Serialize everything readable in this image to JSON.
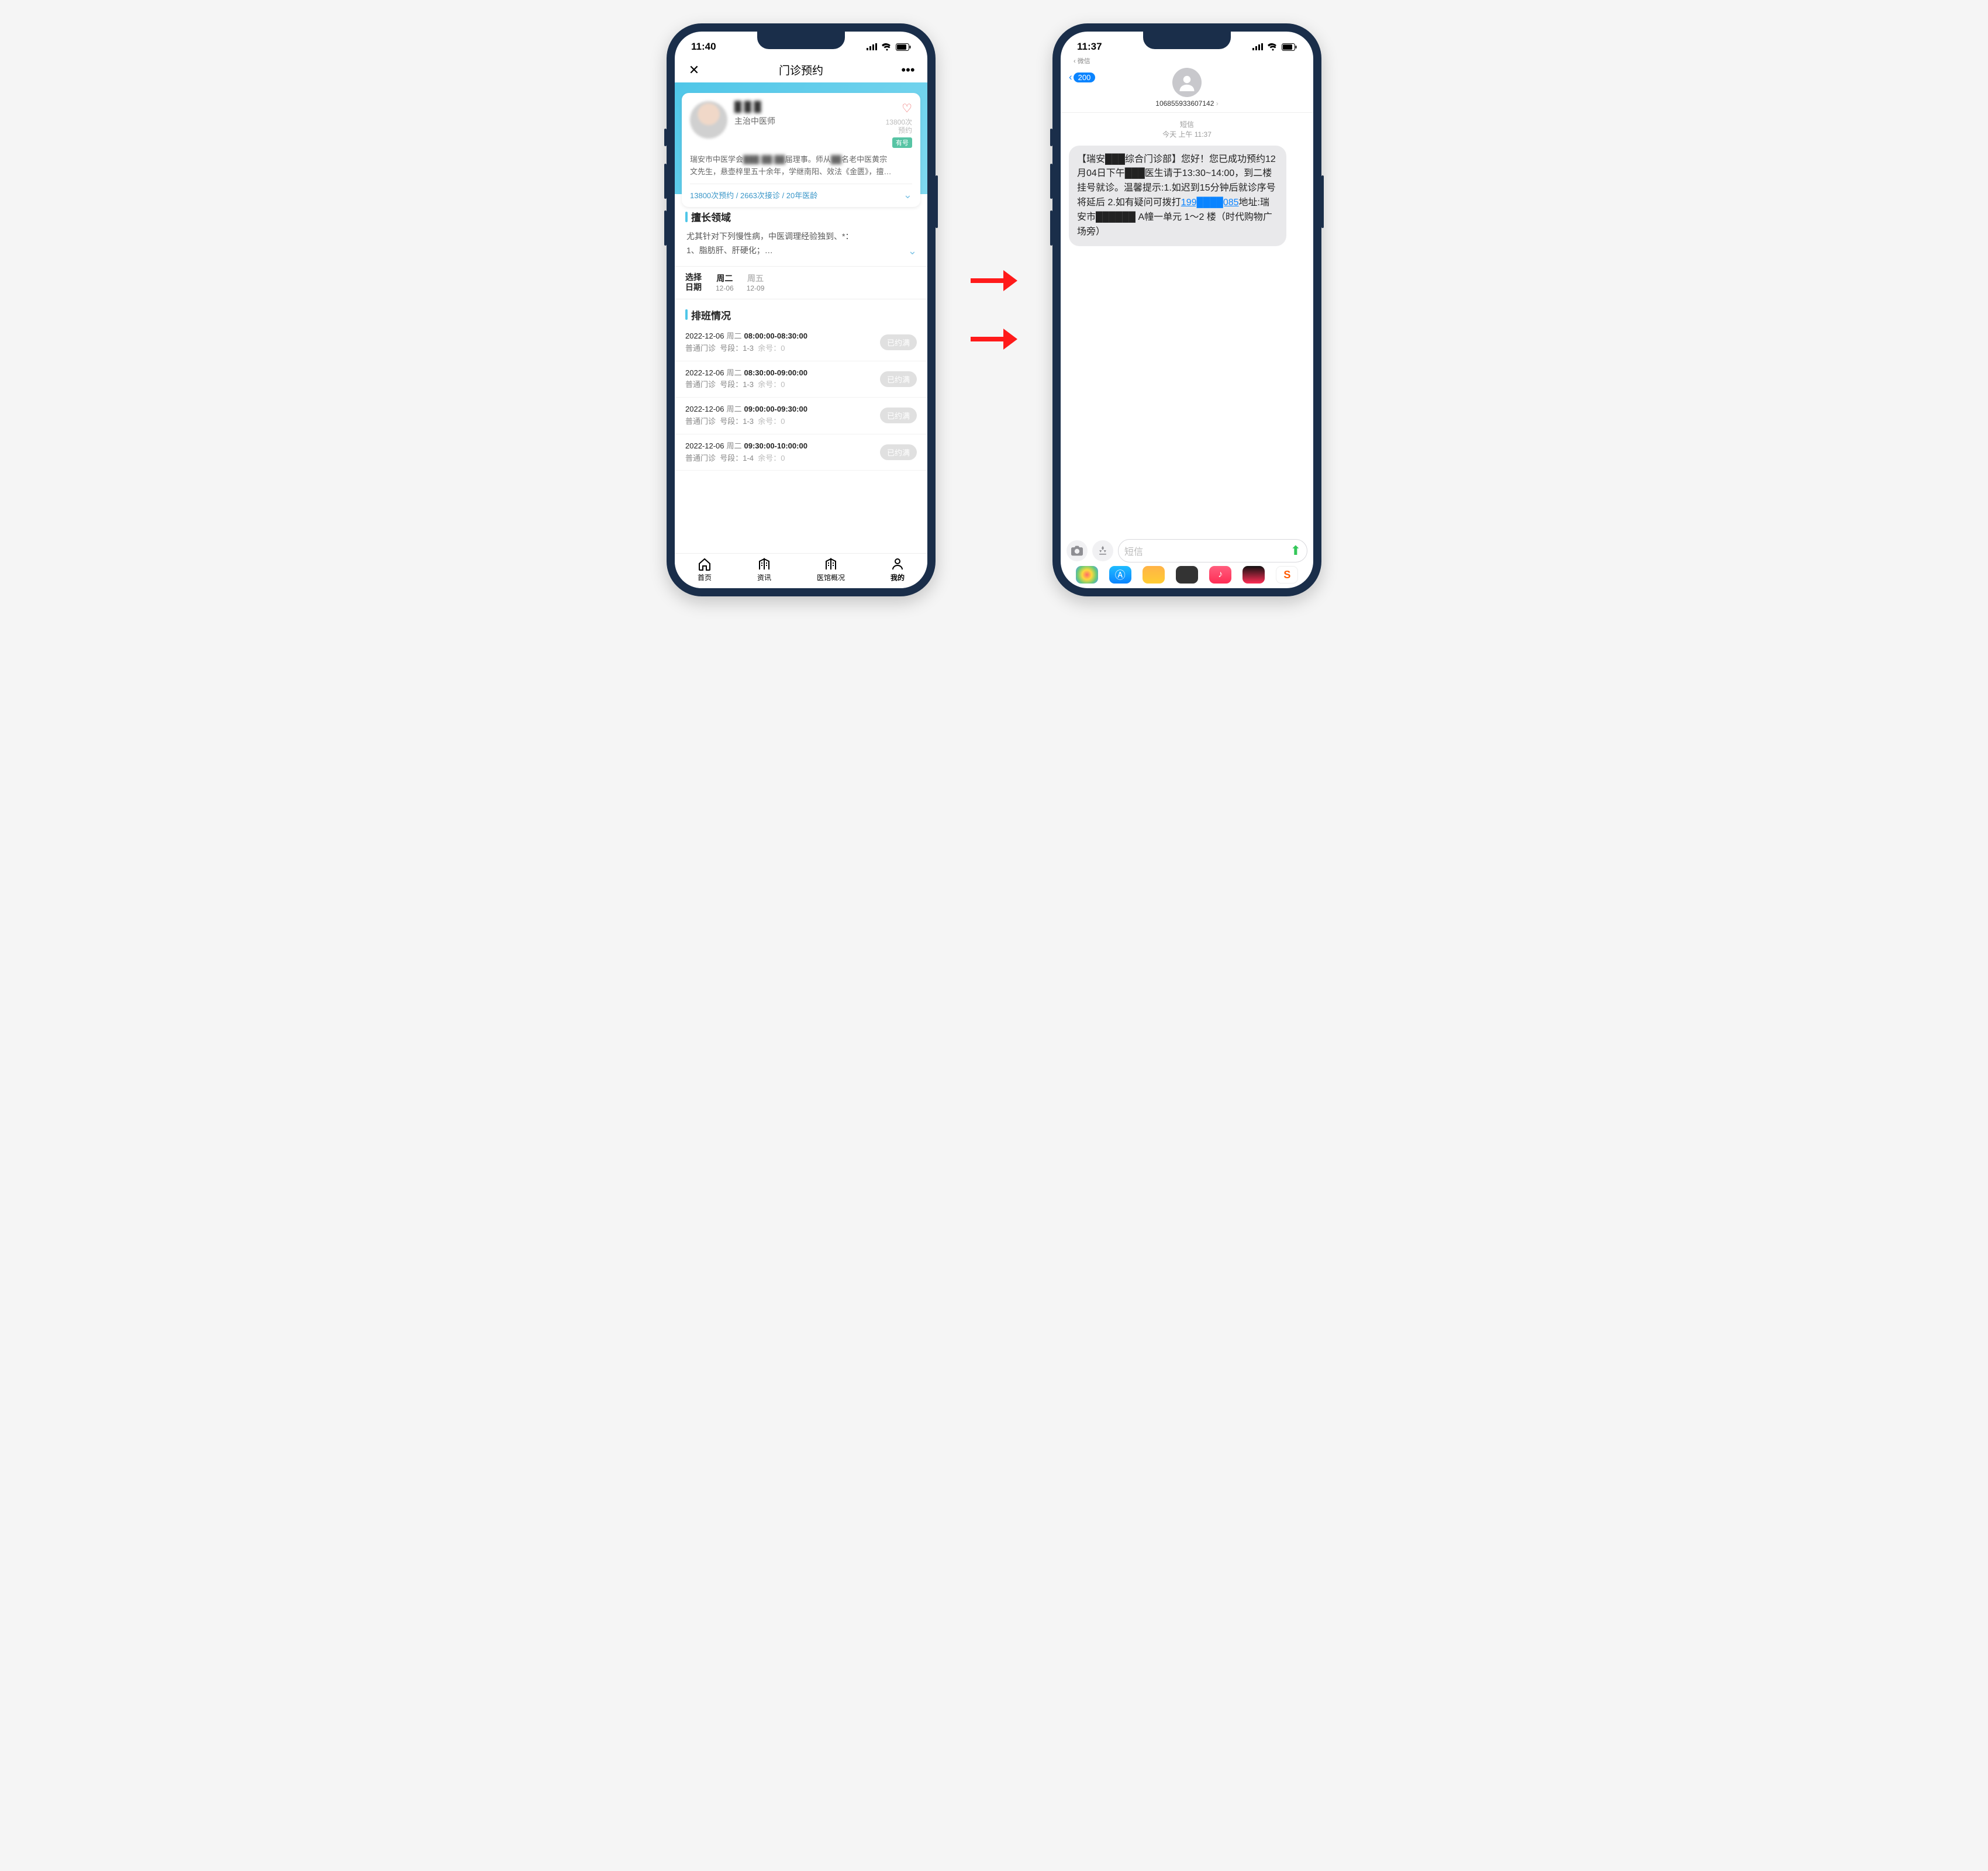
{
  "left": {
    "status": {
      "time": "11:40"
    },
    "nav": {
      "title": "门诊预约"
    },
    "doctor": {
      "name": "█ █ █",
      "title": "主治中医师",
      "count": "13800次",
      "count_label": "预约",
      "tag": "有号",
      "bio1_a": "瑞安市中医学会",
      "bio1_b": "届理事。师从",
      "bio1_c": "名老中医黄宗",
      "bio2": "文先生，悬壶梓里五十余年，学继南阳、效法《金匮》，擅…",
      "stats": "13800次预约 / 2663次接诊 / 20年医龄"
    },
    "expertise": {
      "title": "擅长领域",
      "line1": "尤其针对下列慢性病，中医调理经验独到、*：",
      "line2": "1、脂肪肝、肝硬化；…"
    },
    "dates": {
      "label1": "选择",
      "label2": "日期",
      "options": [
        {
          "dow": "周二",
          "day": "12-06",
          "active": true
        },
        {
          "dow": "周五",
          "day": "12-09",
          "active": false
        }
      ]
    },
    "schedule": {
      "title": "排班情况",
      "slots": [
        {
          "date": "2022-12-06",
          "dow": "周二",
          "time": "08:00:00-08:30:00",
          "type": "普通门诊",
          "range_label": "号段：",
          "range": "1-3",
          "remain_label": "余号：",
          "remain": "0",
          "status": "已约满"
        },
        {
          "date": "2022-12-06",
          "dow": "周二",
          "time": "08:30:00-09:00:00",
          "type": "普通门诊",
          "range_label": "号段：",
          "range": "1-3",
          "remain_label": "余号：",
          "remain": "0",
          "status": "已约满"
        },
        {
          "date": "2022-12-06",
          "dow": "周二",
          "time": "09:00:00-09:30:00",
          "type": "普通门诊",
          "range_label": "号段：",
          "range": "1-3",
          "remain_label": "余号：",
          "remain": "0",
          "status": "已约满"
        },
        {
          "date": "2022-12-06",
          "dow": "周二",
          "time": "09:30:00-10:00:00",
          "type": "普通门诊",
          "range_label": "号段：",
          "range": "1-4",
          "remain_label": "余号：",
          "remain": "0",
          "status": "已约满"
        }
      ]
    },
    "tabs": [
      {
        "label": "首页"
      },
      {
        "label": "资讯"
      },
      {
        "label": "医馆概况"
      },
      {
        "label": "我的"
      }
    ]
  },
  "right": {
    "status": {
      "time": "11:37"
    },
    "breadcrumb": "微信",
    "back_badge": "200",
    "contact": "106855933607142",
    "meta_label": "短信",
    "meta_time": "今天 上午 11:37",
    "bubble_1": "【瑞安███综合门诊部】您好！您已成功预约12月04日下午███医生请于13:30~14:00，到二楼挂号就诊。温馨提示:1.如迟到15分钟后就诊序号将延后 2.如有疑问可拨打",
    "bubble_phone": "199████085",
    "bubble_2": "地址:瑞安市██████ A幢一单元 1～2 楼（时代购物广场旁）",
    "input_placeholder": "短信"
  }
}
